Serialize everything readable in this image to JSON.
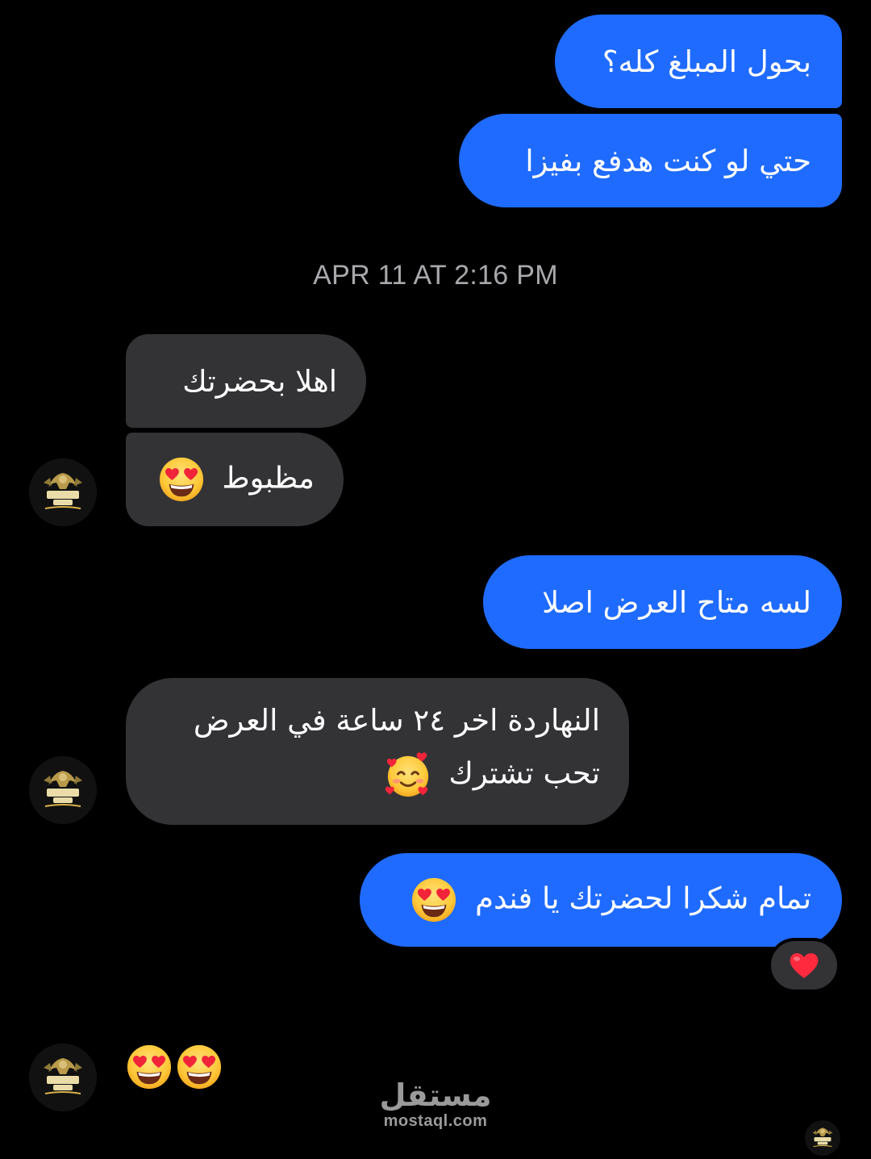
{
  "timestamp": "APR 11 AT 2:16 PM",
  "messages": [
    {
      "from": "me",
      "lines": [
        "بحول المبلغ كله؟"
      ]
    },
    {
      "from": "me",
      "lines": [
        "حتي لو كنت هدفع بفيزا"
      ]
    },
    {
      "from": "them",
      "lines": [
        "اهلا بحضرتك"
      ]
    },
    {
      "from": "them",
      "lines": [
        "مظبوط"
      ],
      "emoji": "heart-eyes"
    },
    {
      "from": "me",
      "lines": [
        "لسه متاح العرض اصلا"
      ]
    },
    {
      "from": "them",
      "lines": [
        "النهاردة اخر ٢٤ ساعة في العرض",
        "تحب تشترك"
      ],
      "emoji": "smiling-face-with-hearts"
    },
    {
      "from": "me",
      "lines": [
        "تمام شكرا لحضرتك يا فندم"
      ],
      "emoji": "heart-eyes"
    },
    {
      "from": "them",
      "emoji_only": [
        "heart-eyes",
        "heart-eyes"
      ]
    }
  ],
  "reaction": {
    "emoji": "red-heart"
  },
  "avatar": {
    "brand": "MONSTER",
    "brand2": "GYM",
    "tagline": "where somebody belong"
  },
  "watermark": {
    "arabic": "مستقل",
    "latin": "mostaql.com"
  },
  "colors": {
    "outgoing": "#1f6bff",
    "incoming": "#333336",
    "background": "#000000",
    "timestamp": "#a9a9ad"
  }
}
